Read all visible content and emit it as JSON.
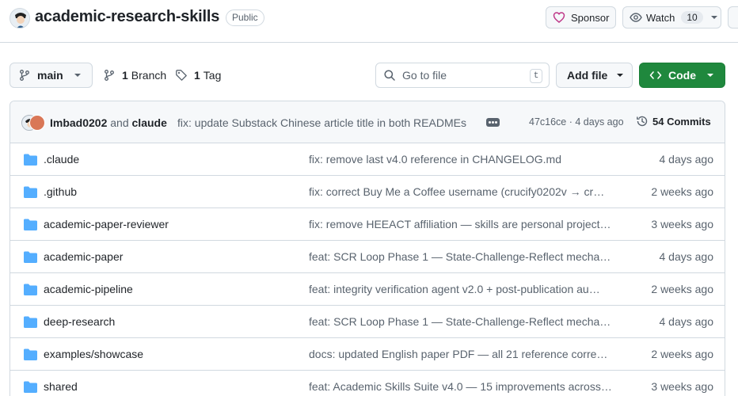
{
  "repo": {
    "name": "academic-research-skills",
    "visibility": "Public"
  },
  "actions": {
    "sponsor_label": "Sponsor",
    "watch_label": "Watch",
    "watch_count": "10"
  },
  "nav": {
    "branch": "main",
    "branch_count": "1",
    "branch_label": "Branch",
    "tag_count": "1",
    "tag_label": "Tag",
    "search_placeholder": "Go to file",
    "search_shortcut": "t",
    "add_file_label": "Add file",
    "code_label": "Code"
  },
  "latest_commit": {
    "author1": "Imbad0202",
    "and": "and",
    "author2": "claude",
    "message": "fix: update Substack Chinese article title in both READMEs",
    "hash_time": "47c16ce · 4 days ago",
    "commit_count": "54 Commits"
  },
  "files": [
    {
      "name": ".claude",
      "commit": "fix: remove last v4.0 reference in CHANGELOG.md",
      "age": "4 days ago"
    },
    {
      "name": ".github",
      "commit": "fix: correct Buy Me a Coffee username (crucify0202v → cr…",
      "age": "2 weeks ago"
    },
    {
      "name": "academic-paper-reviewer",
      "commit": "fix: remove HEEACT affiliation — skills are personal project…",
      "age": "3 weeks ago"
    },
    {
      "name": "academic-paper",
      "commit": "feat: SCR Loop Phase 1 — State-Challenge-Reflect mecha…",
      "age": "4 days ago"
    },
    {
      "name": "academic-pipeline",
      "commit": "feat: integrity verification agent v2.0 + post-publication au…",
      "age": "2 weeks ago"
    },
    {
      "name": "deep-research",
      "commit": "feat: SCR Loop Phase 1 — State-Challenge-Reflect mecha…",
      "age": "4 days ago"
    },
    {
      "name": "examples/showcase",
      "commit": "docs: updated English paper PDF — all 21 reference corre…",
      "age": "2 weeks ago"
    },
    {
      "name": "shared",
      "commit": "feat: Academic Skills Suite v4.0 — 15 improvements across…",
      "age": "3 weeks ago"
    }
  ],
  "colors": {
    "accent_green": "#1f883d",
    "folder_blue": "#54aeff",
    "sponsor_pink": "#bf3989"
  }
}
